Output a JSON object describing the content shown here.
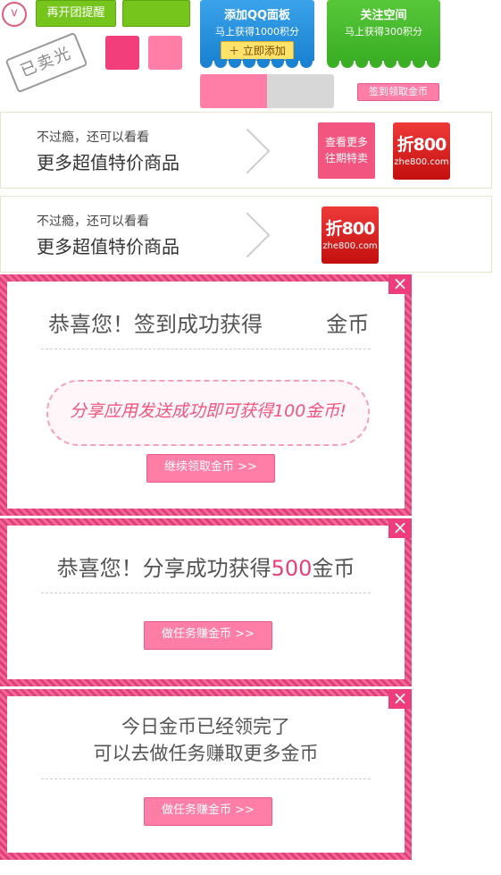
{
  "top": {
    "remind_again": "再开团提醒",
    "qq_panel": {
      "title": "添加QQ面板",
      "subtitle": "马上获得1000积分",
      "button": "立即添加"
    },
    "follow_space": {
      "title": "关注空间",
      "subtitle": "马上获得300积分"
    },
    "sold_out": "已卖光",
    "signin_coins": "签到领取金币"
  },
  "banners": [
    {
      "sub": "不过瘾，还可以看看",
      "main": "更多超值特价商品",
      "more_button": "查看更多 往期特卖",
      "logo_big": "折800",
      "logo_small": "zhe800.com"
    },
    {
      "sub": "不过瘾，还可以看看",
      "main": "更多超值特价商品",
      "logo_big": "折800",
      "logo_small": "zhe800.com"
    }
  ],
  "modals": {
    "signin": {
      "title_prefix": "恭喜您！签到成功获得",
      "title_suffix": "金币",
      "share_tip": "分享应用发送成功即可获得100金币!",
      "button": "继续领取金币 >>"
    },
    "share": {
      "title_prefix": "恭喜您！分享成功获得",
      "amount": "500",
      "title_suffix": "金币",
      "button": "做任务赚金币 >>"
    },
    "done": {
      "line1": "今日金币已经领完了",
      "line2": "可以去做任务赚取更多金币",
      "button": "做任务赚金币 >>"
    }
  },
  "colors": {
    "pink": "#f2557f",
    "green": "#76c51c",
    "blue": "#1f8fdc",
    "red": "#d91a1a"
  }
}
